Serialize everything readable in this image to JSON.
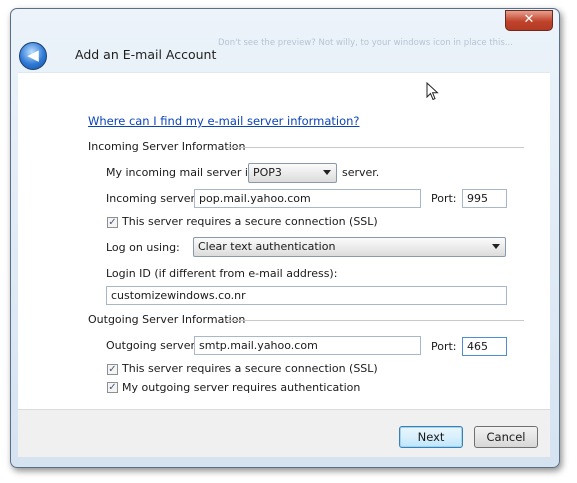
{
  "window": {
    "title": "Add an E-mail Account",
    "background_text": "Don't see the preview? Not willy, to your windows icon in place this...",
    "close_label": "✕",
    "back_label": "◀"
  },
  "help_link": "Where can I find my e-mail server information?",
  "incoming": {
    "section_title": "Incoming Server Information",
    "type_prefix": "My incoming mail server is a",
    "type_value": "POP3",
    "type_suffix": "server.",
    "server_label": "Incoming server:",
    "server_value": "pop.mail.yahoo.com",
    "port_label": "Port:",
    "port_value": "995",
    "ssl_label": "This server requires a secure connection (SSL)",
    "ssl_checked": true,
    "logon_label": "Log on using:",
    "logon_value": "Clear text authentication",
    "login_id_label": "Login ID (if different from e-mail address):",
    "login_id_value": "customizewindows.co.nr"
  },
  "outgoing": {
    "section_title": "Outgoing Server Information",
    "server_label": "Outgoing server:",
    "server_value": "smtp.mail.yahoo.com",
    "port_label": "Port:",
    "port_value": "465",
    "ssl_label": "This server requires a secure connection (SSL)",
    "ssl_checked": true,
    "auth_label": "My outgoing server requires authentication",
    "auth_checked": true
  },
  "buttons": {
    "next": "Next",
    "cancel": "Cancel"
  },
  "check_glyph": "✓"
}
